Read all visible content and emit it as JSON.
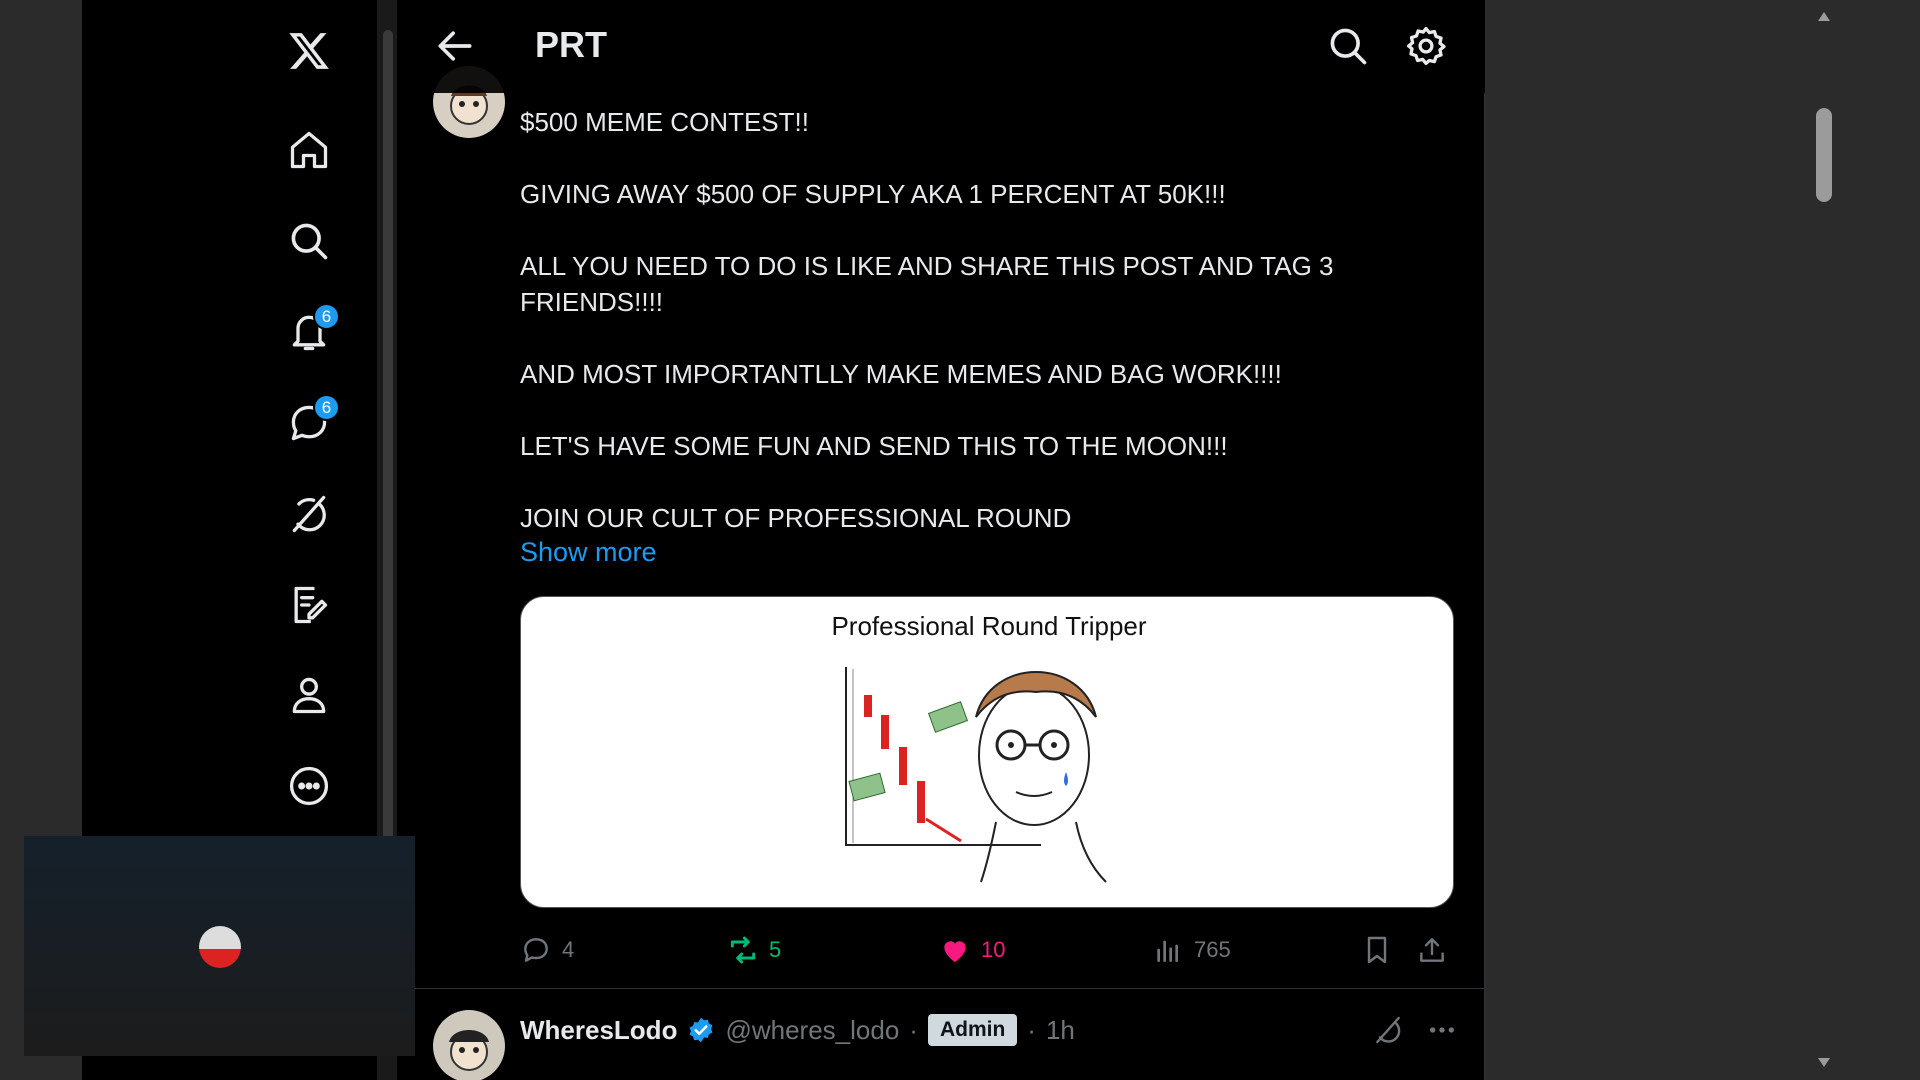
{
  "sidebar": {
    "logo": "x-logo-icon",
    "items": [
      {
        "icon": "home-icon"
      },
      {
        "icon": "search-icon"
      },
      {
        "icon": "bell-icon",
        "badge": "6"
      },
      {
        "icon": "messages-icon",
        "badge": "6"
      },
      {
        "icon": "grok-icon"
      },
      {
        "icon": "compose-icon"
      },
      {
        "icon": "profile-icon"
      },
      {
        "icon": "more-icon"
      }
    ]
  },
  "header": {
    "title": "PRT",
    "back_icon": "arrow-left-icon",
    "search_icon": "search-icon",
    "settings_icon": "gear-icon"
  },
  "post": {
    "text": "$500 MEME CONTEST!!\n\nGIVING AWAY $500 OF SUPPLY AKA 1 PERCENT AT 50K!!!\n\nALL YOU NEED TO DO IS LIKE AND SHARE THIS POST AND TAG 3 FRIENDS!!!!\n\nAND MOST IMPORTANTLLY MAKE MEMES AND BAG WORK!!!!\n\nLET'S HAVE SOME FUN AND SEND THIS TO THE MOON!!!\n\nJOIN OUR CULT OF PROFESSIONAL ROUND",
    "show_more": "Show more",
    "image_caption": "Professional Round Tripper",
    "actions": {
      "replies": "4",
      "reposts": "5",
      "likes": "10",
      "views": "765"
    },
    "colors": {
      "repost": "#00ba7c",
      "like": "#f91880",
      "link": "#1d9bf0"
    }
  },
  "next_post": {
    "name": "WheresLodo",
    "handle": "@wheres_lodo",
    "sep": "·",
    "tag": "Admin",
    "time": "1h"
  }
}
